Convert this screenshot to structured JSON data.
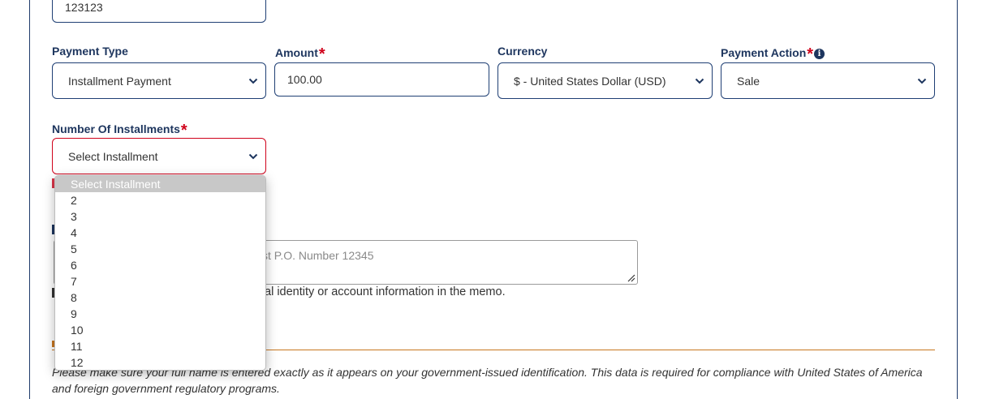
{
  "prev_field": {
    "value": "123123"
  },
  "payment_type": {
    "label": "Payment Type",
    "value": "Installment Payment"
  },
  "amount": {
    "label": "Amount",
    "required": "*",
    "value": "100.00"
  },
  "currency": {
    "label": "Currency",
    "value": "$ - United States Dollar (USD)"
  },
  "payment_action": {
    "label": "Payment Action",
    "required": "*",
    "info_glyph": "i",
    "value": "Sale"
  },
  "installments": {
    "label": "Number Of Installments",
    "required": "*",
    "value": "Select Installment",
    "options": [
      "Select Installment",
      "2",
      "3",
      "4",
      "5",
      "6",
      "7",
      "8",
      "9",
      "10",
      "11",
      "12"
    ],
    "selected_option": "Select Installment"
  },
  "memo": {
    "placeholder_visible": "st P.O. Number 12345",
    "note_visible": "al identity or account information in the memo."
  },
  "disclaimer": "Please make sure your full name is entered exactly as it appears on your government-issued identification. This data is required for compliance with United States of America and foreign government regulatory programs.",
  "colors": {
    "label": "#1d355e",
    "border": "#1f3f74",
    "required": "#d0021b",
    "error_border": "#d0021b",
    "divider": "#c8761f",
    "selected_option_bg": "#c8c8c8"
  }
}
